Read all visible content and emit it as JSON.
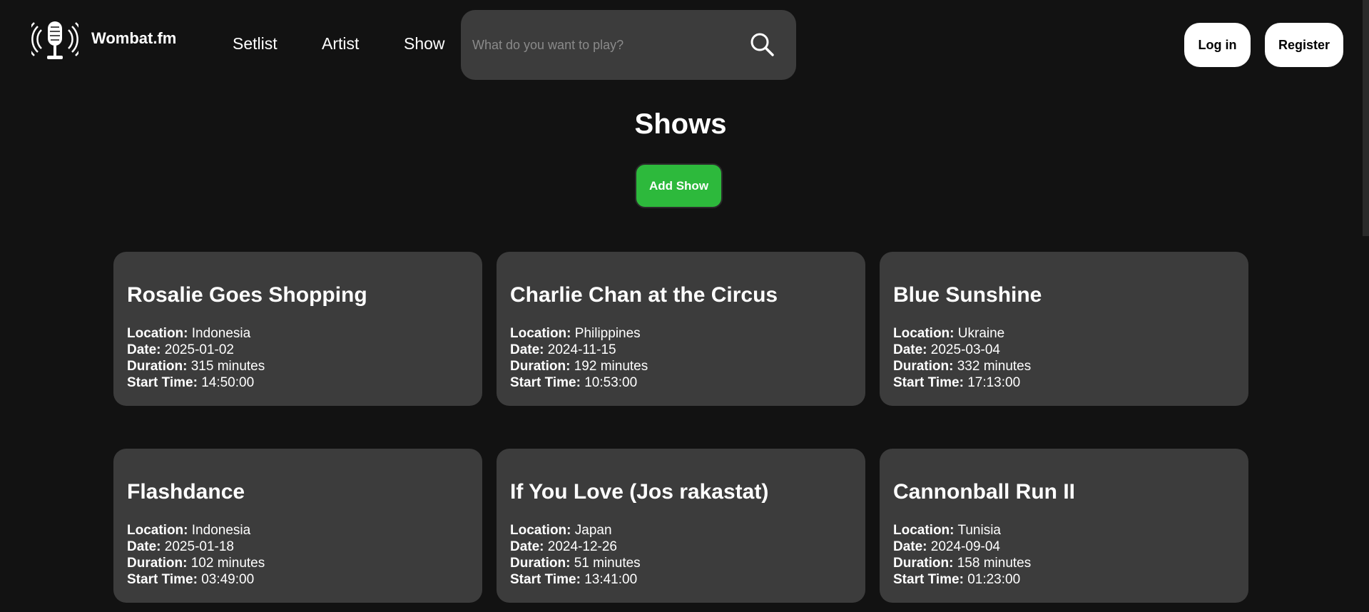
{
  "brand": {
    "name": "Wombat.fm",
    "logo_icon": "microphone-icon"
  },
  "nav": {
    "setlist": "Setlist",
    "artist": "Artist",
    "show": "Show"
  },
  "search": {
    "placeholder": "What do you want to play?",
    "value": "",
    "icon": "search-icon"
  },
  "auth": {
    "login": "Log in",
    "register": "Register"
  },
  "main": {
    "title": "Shows",
    "add_button": "Add Show"
  },
  "labels": {
    "location": "Location:",
    "date": "Date:",
    "duration": "Duration:",
    "start_time": "Start Time:"
  },
  "shows": [
    {
      "title": "Rosalie Goes Shopping",
      "location": "Indonesia",
      "date": "2025-01-02",
      "duration": "315 minutes",
      "start_time": "14:50:00"
    },
    {
      "title": "Charlie Chan at the Circus",
      "location": "Philippines",
      "date": "2024-11-15",
      "duration": "192 minutes",
      "start_time": "10:53:00"
    },
    {
      "title": "Blue Sunshine",
      "location": "Ukraine",
      "date": "2025-03-04",
      "duration": "332 minutes",
      "start_time": "17:13:00"
    },
    {
      "title": "Flashdance",
      "location": "Indonesia",
      "date": "2025-01-18",
      "duration": "102 minutes",
      "start_time": "03:49:00"
    },
    {
      "title": "If You Love (Jos rakastat)",
      "location": "Japan",
      "date": "2024-12-26",
      "duration": "51 minutes",
      "start_time": "13:41:00"
    },
    {
      "title": "Cannonball Run II",
      "location": "Tunisia",
      "date": "2024-09-04",
      "duration": "158 minutes",
      "start_time": "01:23:00"
    }
  ],
  "colors": {
    "background": "#121212",
    "card": "#3c3c3c",
    "accent_green": "#2db93c",
    "button_white": "#ffffff"
  }
}
